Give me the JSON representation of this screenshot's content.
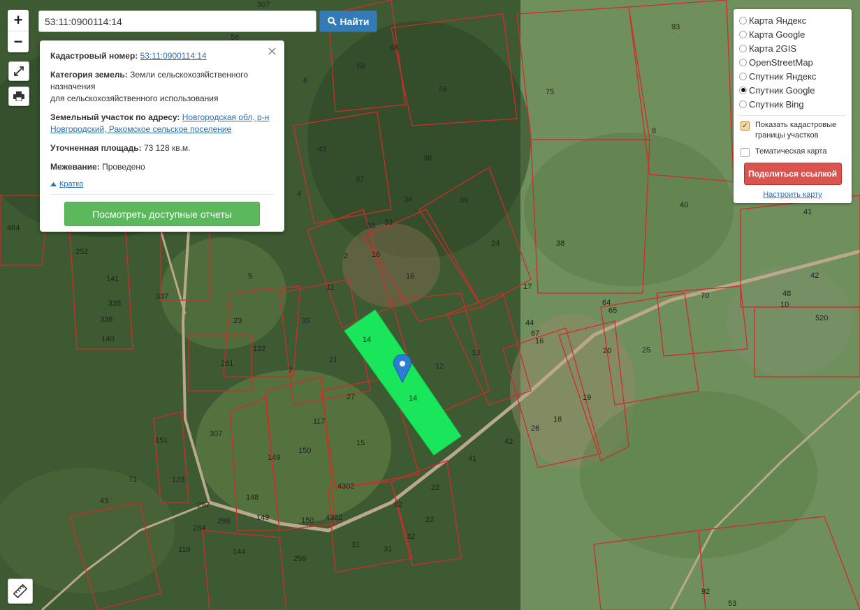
{
  "search": {
    "value": "53:11:0900114:14",
    "button_label": "Найти"
  },
  "controls": {
    "zoom_in": "+",
    "zoom_out": "−"
  },
  "popup": {
    "cadastral_label": "Кадастровый номер:",
    "cadastral_value": "53:11:0900114:14",
    "category_label": "Категория земель:",
    "category_value_1": "Земли сельскохозяйственного назначения",
    "category_value_2": "для сельскохозяйственного использования",
    "address_label": "Земельный участок по адресу:",
    "address_value": "Новгородская обл, р-н Новгородский, Ракомское сельское поселение",
    "area_label": "Уточненная площадь:",
    "area_value": "73 128 кв.м.",
    "survey_label": "Межевание:",
    "survey_value": "Проведено",
    "short_link": "Кратко",
    "reports_button": "Посмотреть доступные отчеты"
  },
  "layers": {
    "options": [
      {
        "label": "Карта Яндекс",
        "selected": false
      },
      {
        "label": "Карта Google",
        "selected": false
      },
      {
        "label": "Карта 2GIS",
        "selected": false
      },
      {
        "label": "OpenStreetMap",
        "selected": false
      },
      {
        "label": "Спутник Яндекс",
        "selected": false
      },
      {
        "label": "Спутник Google",
        "selected": true
      },
      {
        "label": "Спутник Bing",
        "selected": false
      }
    ],
    "show_borders": "Показать кадастровые границы участков",
    "show_borders_checked": true,
    "thematic": "Тематическая карта",
    "thematic_checked": false,
    "share_button": "Поделиться ссылкой",
    "config_link": "Настроить карту"
  },
  "map": {
    "highlight_color": "#19e65a",
    "border_color": "#d42a2a",
    "parcel_labels": [
      "307",
      "56",
      "68",
      "68",
      "6",
      "76",
      "93",
      "75",
      "8",
      "43",
      "36",
      "37",
      "34",
      "39",
      "4",
      "24",
      "38",
      "40",
      "41",
      "484",
      "252",
      "141",
      "335",
      "336",
      "140",
      "337",
      "2",
      "11",
      "16",
      "5",
      "35",
      "23",
      "21",
      "12",
      "13",
      "14",
      "14",
      "17",
      "70",
      "42",
      "520",
      "64",
      "65",
      "44",
      "67",
      "16",
      "20",
      "25",
      "122",
      "261",
      "7",
      "27",
      "19",
      "26",
      "18",
      "117",
      "15",
      "150",
      "149",
      "307",
      "151",
      "123",
      "148",
      "149",
      "150",
      "4302",
      "4302",
      "41",
      "42",
      "22",
      "32",
      "22",
      "32",
      "31",
      "31",
      "71",
      "43",
      "297",
      "298",
      "284",
      "118",
      "144",
      "259",
      "48",
      "10",
      "92",
      "53",
      "33",
      "33",
      "16"
    ]
  }
}
